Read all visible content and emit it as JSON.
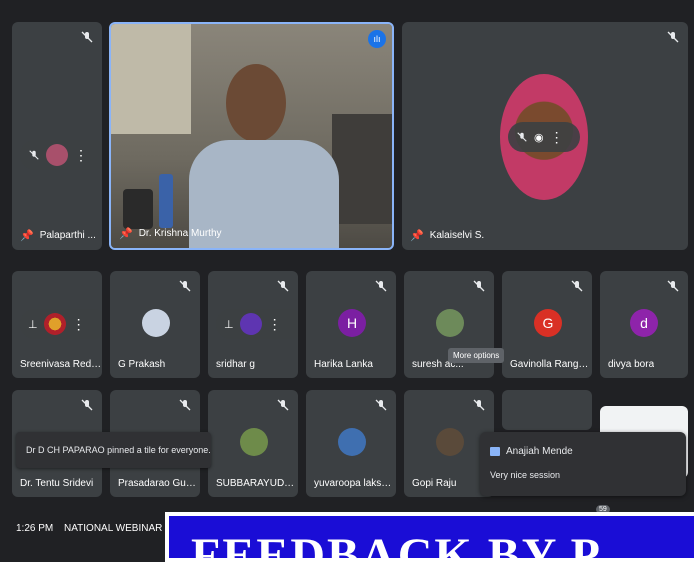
{
  "top_row": {
    "tile1_name": "Palaparthi ...",
    "tile2_name": "Dr. Krishna Murthy",
    "tile3_name": "Kalaiselvi S."
  },
  "mid_row": [
    {
      "name": "Sreenivasa Redd..."
    },
    {
      "name": "G Prakash"
    },
    {
      "name": "sridhar g"
    },
    {
      "name": "Harika Lanka",
      "initial": "H",
      "color": "#7b1fa2"
    },
    {
      "name": "suresh ac..."
    },
    {
      "name": "Gavinolla Ranga ...",
      "initial": "G",
      "color": "#d93025"
    },
    {
      "name": "divya bora",
      "initial": "d",
      "color": "#8e24aa"
    }
  ],
  "bottom_row": [
    {
      "name": "Dr. Tentu Sridevi"
    },
    {
      "name": "Prasadarao Gunn..."
    },
    {
      "name": "SUBBARAYUDU K..."
    },
    {
      "name": "yuvaroopa lakshmi"
    },
    {
      "name": "Gopi Raju"
    }
  ],
  "tooltip": "More options",
  "toast": "Dr D CH PAPARAO pinned a tile for everyone.",
  "chat": {
    "author": "Anajiah Mende",
    "message": "Very nice session"
  },
  "participants_badge": "59",
  "bottom": {
    "time": "1:26 PM",
    "meeting_title": "NATIONAL WEBINAR LI"
  },
  "banner_text": "FEEDBACK BY P",
  "colors": {
    "accent": "#1a73e8",
    "banner": "#1a0dd6",
    "tile": "#3c4043"
  }
}
